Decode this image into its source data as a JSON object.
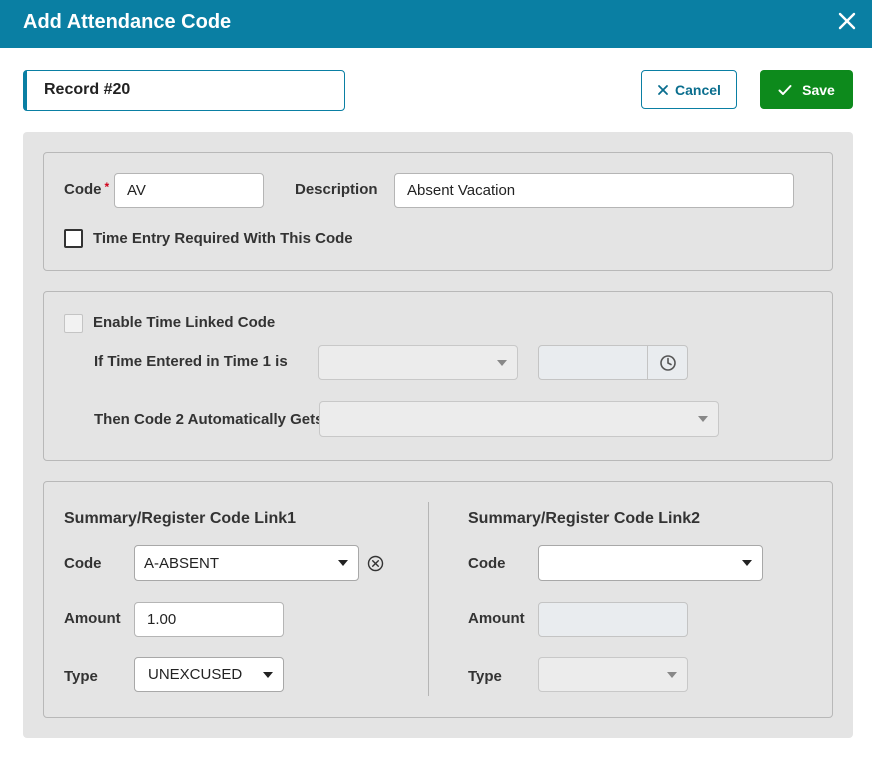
{
  "header": {
    "title": "Add Attendance Code"
  },
  "record": {
    "label": "Record #20"
  },
  "buttons": {
    "cancel": "Cancel",
    "save": "Save"
  },
  "colors": {
    "header": "#0a7fa3",
    "save": "#0d8a1c",
    "required": "#d0021b"
  },
  "code_section": {
    "code_label": "Code",
    "required_mark": "*",
    "code_value": "AV",
    "description_label": "Description",
    "description_value": "Absent Vacation",
    "time_entry_label": "Time Entry Required With This Code",
    "time_entry_checked": false
  },
  "time_link_section": {
    "enable_label": "Enable Time Linked Code",
    "enable_checked": false,
    "if_time_label": "If Time Entered in Time 1 is",
    "if_time_select": "",
    "time_value": "",
    "then_code_label": "Then Code 2 Automatically Gets",
    "then_code_select": ""
  },
  "link1": {
    "heading": "Summary/Register Code Link1",
    "code_label": "Code",
    "code_value": "A-ABSENT",
    "amount_label": "Amount",
    "amount_value": "1.00",
    "type_label": "Type",
    "type_value": "UNEXCUSED"
  },
  "link2": {
    "heading": "Summary/Register Code Link2",
    "code_label": "Code",
    "code_value": "",
    "amount_label": "Amount",
    "amount_value": "",
    "type_label": "Type",
    "type_value": ""
  }
}
